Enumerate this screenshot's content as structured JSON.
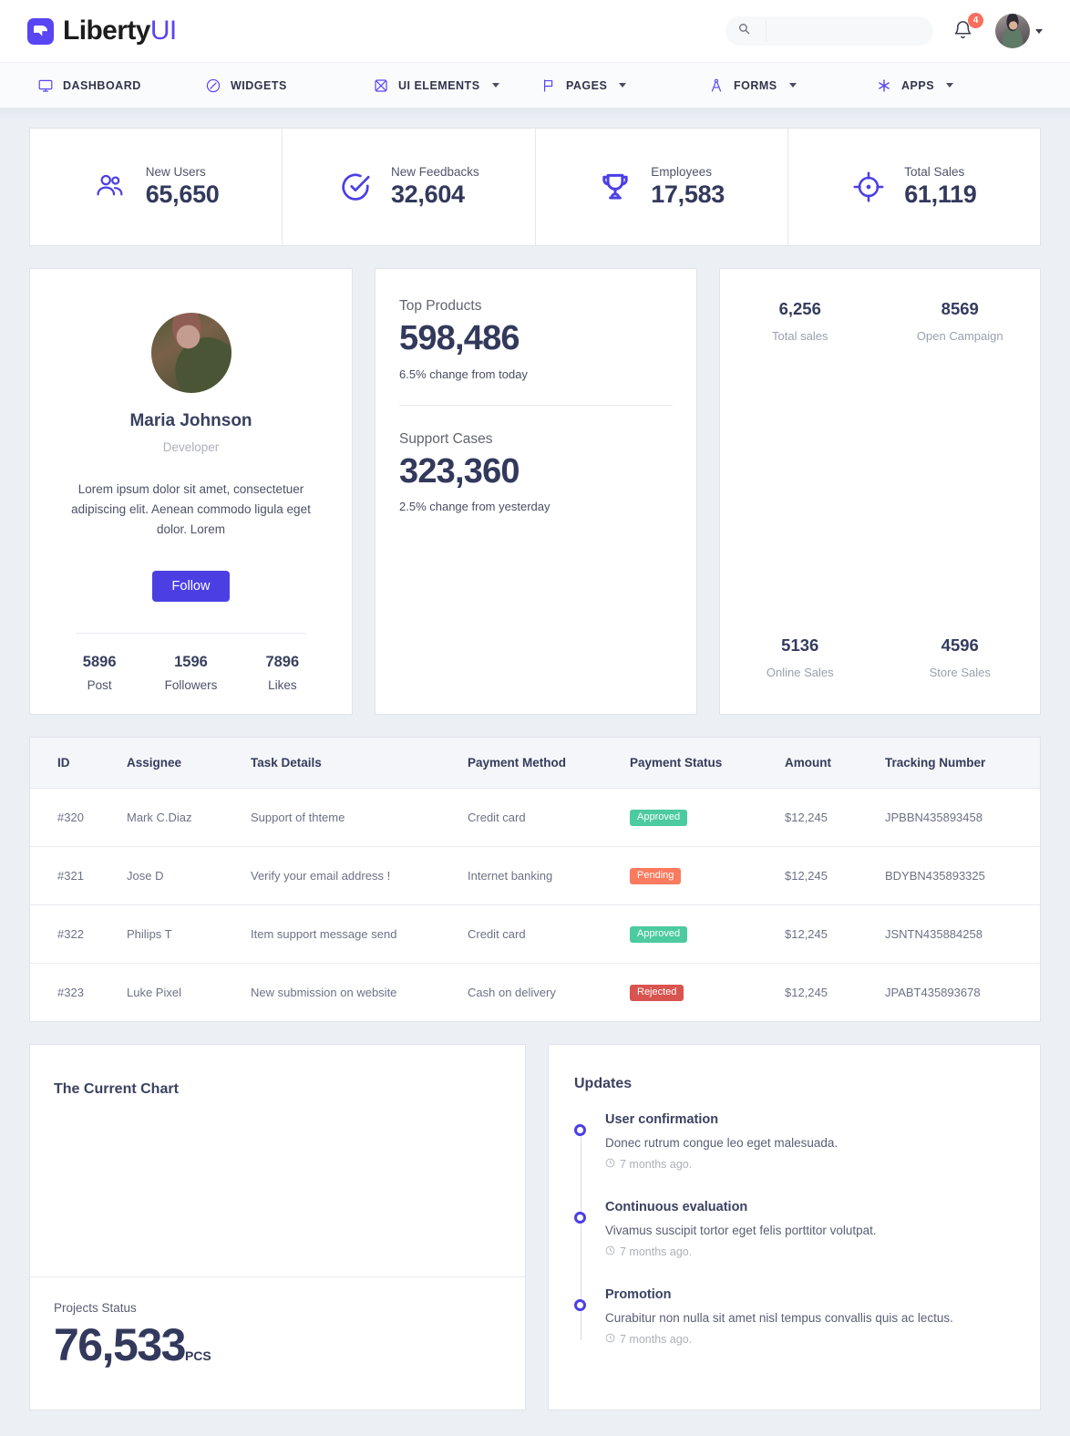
{
  "brand": {
    "name": "Liberty",
    "suffix": "UI"
  },
  "topbar": {
    "search_placeholder": "",
    "search_value": "",
    "notification_count": "4"
  },
  "nav": {
    "items": [
      {
        "label": "DASHBOARD",
        "icon": "monitor-icon",
        "has_caret": false
      },
      {
        "label": "WIDGETS",
        "icon": "compass-icon",
        "has_caret": false
      },
      {
        "label": "UI ELEMENTS",
        "icon": "atom-icon",
        "has_caret": true
      },
      {
        "label": "PAGES",
        "icon": "flag-icon",
        "has_caret": true
      },
      {
        "label": "FORMS",
        "icon": "compass-draw-icon",
        "has_caret": true
      },
      {
        "label": "APPS",
        "icon": "asterisk-icon",
        "has_caret": true
      }
    ]
  },
  "stats": [
    {
      "label": "New Users",
      "value": "65,650",
      "icon": "users-icon"
    },
    {
      "label": "New Feedbacks",
      "value": "32,604",
      "icon": "check-circle-icon"
    },
    {
      "label": "Employees",
      "value": "17,583",
      "icon": "trophy-icon"
    },
    {
      "label": "Total Sales",
      "value": "61,119",
      "icon": "target-icon"
    }
  ],
  "profile": {
    "name": "Maria Johnson",
    "role": "Developer",
    "bio": "Lorem ipsum dolor sit amet, consectetuer adipiscing elit. Aenean commodo ligula eget dolor. Lorem",
    "follow_label": "Follow",
    "stats": [
      {
        "value": "5896",
        "label": "Post"
      },
      {
        "value": "1596",
        "label": "Followers"
      },
      {
        "value": "7896",
        "label": "Likes"
      }
    ]
  },
  "products": {
    "top_products": {
      "title": "Top Products",
      "value": "598,486",
      "change": "6.5% change from today"
    },
    "support_cases": {
      "title": "Support Cases",
      "value": "323,360",
      "change": "2.5% change from yesterday"
    }
  },
  "sales": {
    "top": [
      {
        "value": "6,256",
        "label": "Total sales"
      },
      {
        "value": "8569",
        "label": "Open Campaign"
      }
    ],
    "bottom": [
      {
        "value": "5136",
        "label": "Online Sales"
      },
      {
        "value": "4596",
        "label": "Store Sales"
      }
    ]
  },
  "table": {
    "columns": [
      "ID",
      "Assignee",
      "Task Details",
      "Payment Method",
      "Payment Status",
      "Amount",
      "Tracking Number"
    ],
    "rows": [
      {
        "id": "#320",
        "assignee": "Mark C.Diaz",
        "task": "Support of thteme",
        "method": "Credit card",
        "status": "Approved",
        "status_kind": "approved",
        "amount": "$12,245",
        "tracking": "JPBBN435893458"
      },
      {
        "id": "#321",
        "assignee": "Jose D",
        "task": "Verify your email address !",
        "method": "Internet banking",
        "status": "Pending",
        "status_kind": "pending",
        "amount": "$12,245",
        "tracking": "BDYBN435893325"
      },
      {
        "id": "#322",
        "assignee": "Philips T",
        "task": "Item support message send",
        "method": "Credit card",
        "status": "Approved",
        "status_kind": "approved",
        "amount": "$12,245",
        "tracking": "JSNTN435884258"
      },
      {
        "id": "#323",
        "assignee": "Luke Pixel",
        "task": "New submission on website",
        "method": "Cash on delivery",
        "status": "Rejected",
        "status_kind": "rejected",
        "amount": "$12,245",
        "tracking": "JPABT435893678"
      }
    ]
  },
  "chart_panel": {
    "title": "The Current Chart",
    "footer_label": "Projects Status",
    "footer_value": "76,533",
    "footer_unit": "PCS"
  },
  "updates": {
    "title": "Updates",
    "items": [
      {
        "title": "User confirmation",
        "desc": "Donec rutrum congue leo eget malesuada.",
        "time": "7 months ago."
      },
      {
        "title": "Continuous evaluation",
        "desc": "Vivamus suscipit tortor eget felis porttitor volutpat.",
        "time": "7 months ago."
      },
      {
        "title": "Promotion",
        "desc": "Curabitur non nulla sit amet nisl tempus convallis quis ac lectus.",
        "time": "7 months ago."
      }
    ]
  },
  "colors": {
    "accent": "#4b3fe4",
    "brand": "#5945f3",
    "approved": "#4ccaa0",
    "pending": "#fa7b5f",
    "rejected": "#d9534f",
    "page_bg": "#eceff4"
  }
}
